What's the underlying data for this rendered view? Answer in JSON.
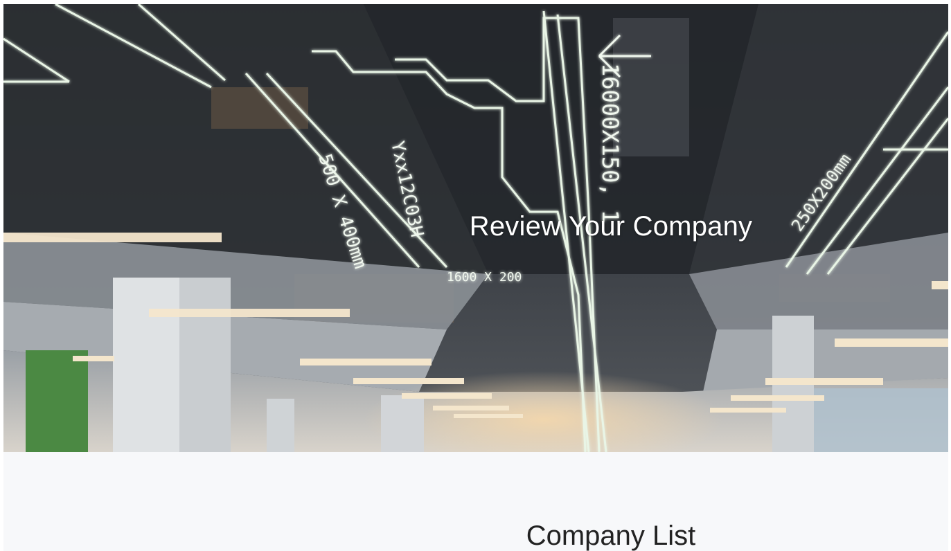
{
  "hero": {
    "title": "Review Your Company",
    "image_alt": "office-interior-photo",
    "ceiling_labels": [
      "500 X 400mm",
      "Yxx12C03H",
      "16000X150, 1",
      "250X200mm",
      "1600 X 200"
    ]
  },
  "company_list": {
    "title": "Company List"
  },
  "colors": {
    "hero_title": "#ffffff",
    "section_background": "#f7f8fa",
    "section_title": "#222222",
    "led_glow": "#e9f5e6"
  }
}
